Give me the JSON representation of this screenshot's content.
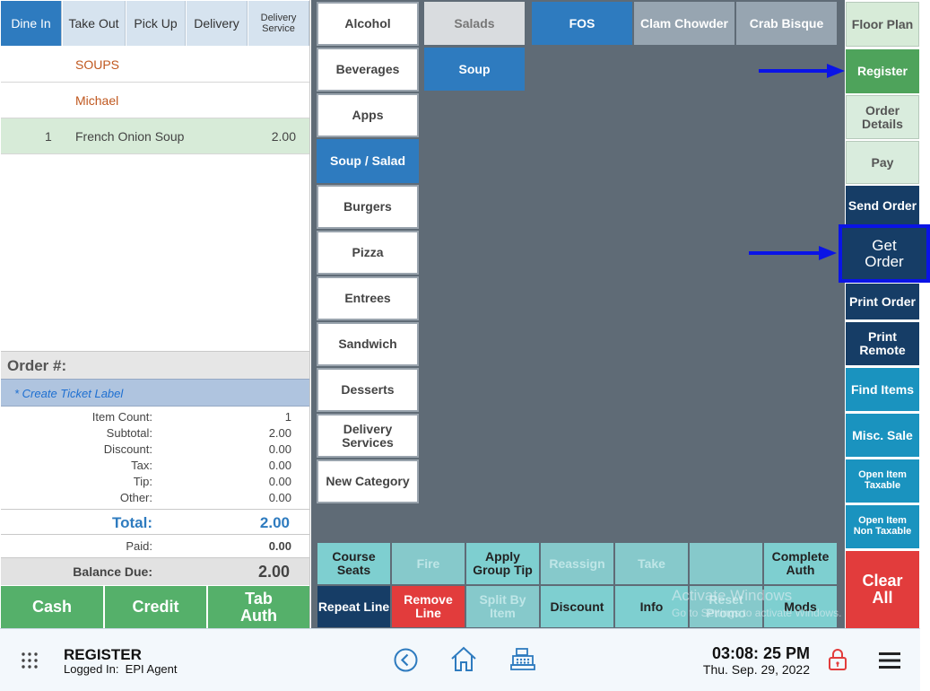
{
  "order_types": [
    {
      "label": "Dine In",
      "active": true
    },
    {
      "label": "Take Out",
      "active": false
    },
    {
      "label": "Pick Up",
      "active": false
    },
    {
      "label": "Delivery",
      "active": false
    },
    {
      "label": "Delivery Service",
      "active": false
    }
  ],
  "order": {
    "course_header": "SOUPS",
    "seat_name": "Michael",
    "items": [
      {
        "qty": "1",
        "name": "French Onion Soup",
        "price": "2.00"
      }
    ],
    "order_number_label": "Order #:",
    "ticket_label_placeholder": "* Create Ticket Label"
  },
  "totals": {
    "item_count_label": "Item Count:",
    "item_count": "1",
    "subtotal_label": "Subtotal:",
    "subtotal": "2.00",
    "discount_label": "Discount:",
    "discount": "0.00",
    "tax_label": "Tax:",
    "tax": "0.00",
    "tip_label": "Tip:",
    "tip": "0.00",
    "other_label": "Other:",
    "other": "0.00",
    "total_label": "Total:",
    "total": "2.00",
    "paid_label": "Paid:",
    "paid": "0.00",
    "balance_label": "Balance Due:",
    "balance": "2.00"
  },
  "payment_buttons": {
    "cash": "Cash",
    "credit": "Credit",
    "tab_auth": "Tab Auth"
  },
  "categories": [
    {
      "label": "Alcohol",
      "active": false
    },
    {
      "label": "Beverages",
      "active": false
    },
    {
      "label": "Apps",
      "active": false
    },
    {
      "label": "Soup / Salad",
      "active": true
    },
    {
      "label": "Burgers",
      "active": false
    },
    {
      "label": "Pizza",
      "active": false
    },
    {
      "label": "Entrees",
      "active": false
    },
    {
      "label": "Sandwich",
      "active": false
    },
    {
      "label": "Desserts",
      "active": false
    },
    {
      "label": "Delivery Services",
      "active": false
    },
    {
      "label": "New Category",
      "active": false
    }
  ],
  "subcategories": {
    "salads": "Salads",
    "soup": "Soup"
  },
  "menu_items": {
    "fos": "FOS",
    "clam_chowder": "Clam Chowder",
    "crab_bisque": "Crab Bisque"
  },
  "actions": {
    "course_seats": "Course Seats",
    "fire": "Fire",
    "apply_group_tip": "Apply Group Tip",
    "reassign": "Reassign",
    "take": "Take",
    "blank": "",
    "complete_auth": "Complete Auth",
    "repeat_line": "Repeat Line",
    "remove_line": "Remove Line",
    "split_by_item": "Split By Item",
    "discount": "Discount",
    "info": "Info",
    "reset_promo": "Reset Promo",
    "mods": "Mods"
  },
  "right_panel": {
    "floor_plan": "Floor Plan",
    "register": "Register",
    "order_details": "Order Details",
    "pay": "Pay",
    "send_order": "Send Order",
    "get_order": "Get Order",
    "print_order": "Print Order",
    "print_remote": "Print Remote",
    "find_items": "Find Items",
    "misc_sale": "Misc. Sale",
    "open_item_taxable": "Open Item Taxable",
    "open_item_non_taxable": "Open Item Non Taxable",
    "clear_all": "Clear All"
  },
  "watermark": {
    "line1": "Activate Windows",
    "line2": "Go to Settings to activate Windows."
  },
  "footer": {
    "title": "REGISTER",
    "logged_in": "Logged In:  EPI Agent",
    "time": "03:08: 25 PM",
    "date": "Thu. Sep. 29, 2022"
  },
  "icons": [
    "grid-icon",
    "back-icon",
    "home-icon",
    "register-icon",
    "lock-icon",
    "menu-icon",
    "arrow-icon"
  ],
  "colors": {
    "blue": "#2e7bbf",
    "navy": "#163d66",
    "teal": "#1a93bf",
    "green": "#55b06a",
    "red": "#e23c3c",
    "aqua": "#7ecfd0",
    "annotation_blue": "#0a14e6",
    "slate_bg": "#5f6b76"
  }
}
